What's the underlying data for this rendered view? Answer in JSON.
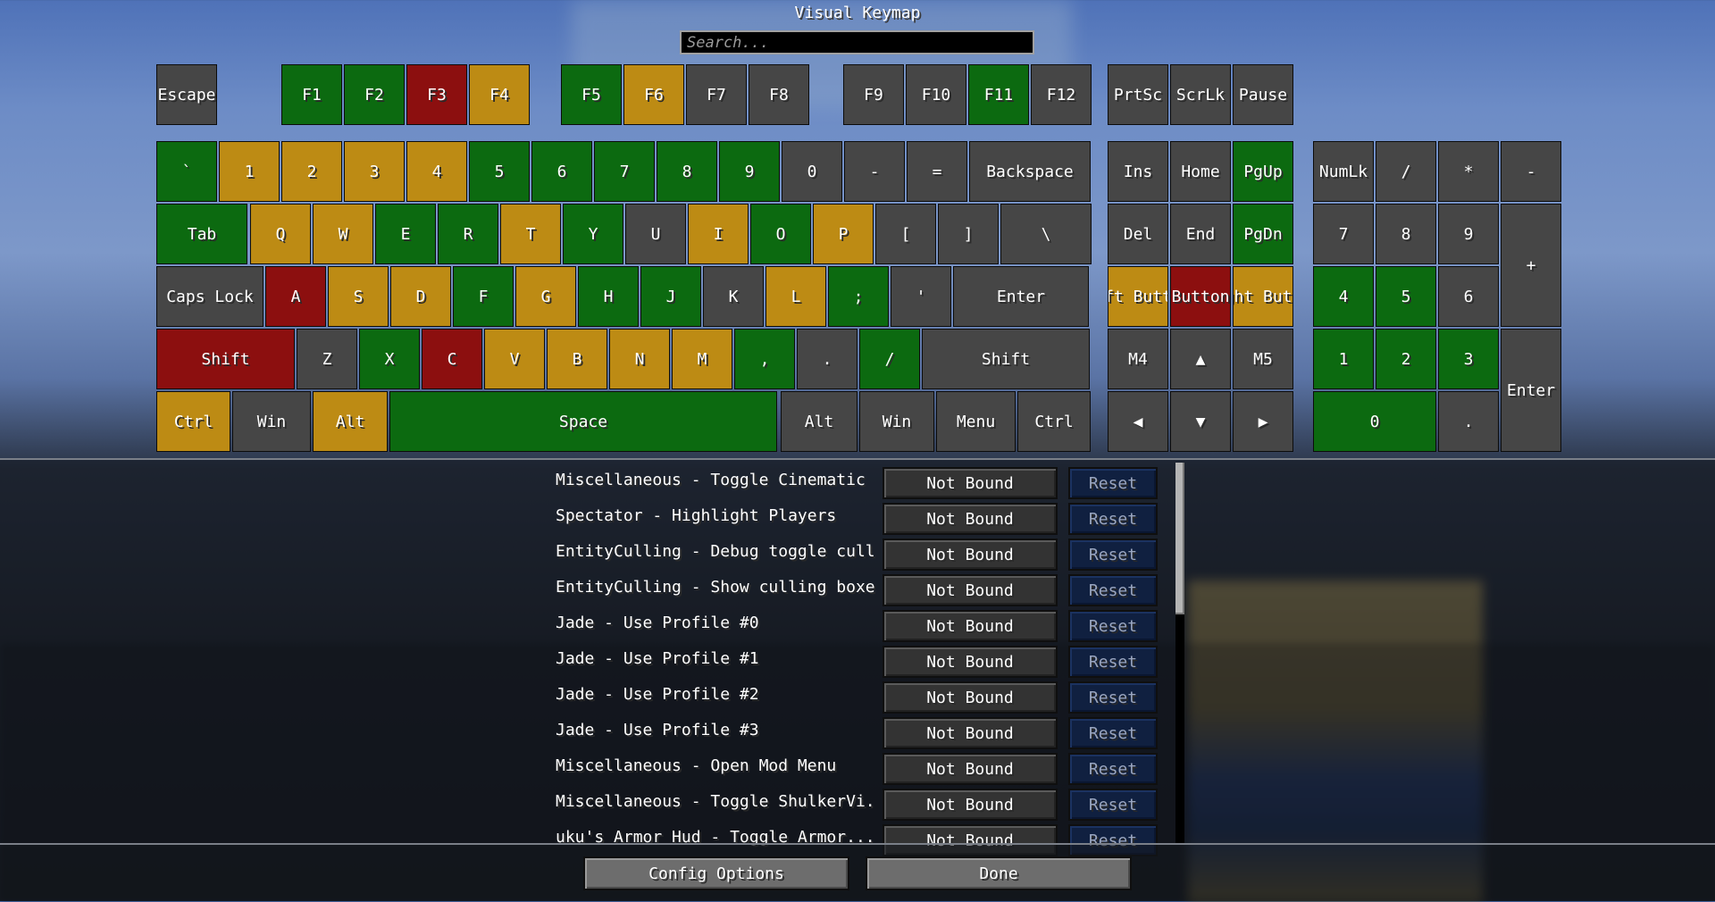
{
  "title": "Visual Keymap",
  "search": {
    "placeholder": "Search..."
  },
  "colors": {
    "bound_unique": "#0c6a10",
    "bound_other": "#bd8b14",
    "conflict": "#8c0f0f",
    "unbound": "#464646"
  },
  "keys": [
    {
      "label": "Escape",
      "state": "unbound"
    },
    {
      "label": "F1",
      "state": "bound_unique"
    },
    {
      "label": "F2",
      "state": "bound_unique"
    },
    {
      "label": "F3",
      "state": "conflict"
    },
    {
      "label": "F4",
      "state": "bound_other"
    },
    {
      "label": "F5",
      "state": "bound_unique"
    },
    {
      "label": "F6",
      "state": "bound_other"
    },
    {
      "label": "F7",
      "state": "unbound"
    },
    {
      "label": "F8",
      "state": "unbound"
    },
    {
      "label": "F9",
      "state": "unbound"
    },
    {
      "label": "F10",
      "state": "unbound"
    },
    {
      "label": "F11",
      "state": "bound_unique"
    },
    {
      "label": "F12",
      "state": "unbound"
    },
    {
      "label": "PrtSc",
      "state": "unbound"
    },
    {
      "label": "ScrLk",
      "state": "unbound"
    },
    {
      "label": "Pause",
      "state": "unbound"
    },
    {
      "label": "`",
      "state": "bound_unique"
    },
    {
      "label": "1",
      "state": "bound_other"
    },
    {
      "label": "2",
      "state": "bound_other"
    },
    {
      "label": "3",
      "state": "bound_other"
    },
    {
      "label": "4",
      "state": "bound_other"
    },
    {
      "label": "5",
      "state": "bound_unique"
    },
    {
      "label": "6",
      "state": "bound_unique"
    },
    {
      "label": "7",
      "state": "bound_unique"
    },
    {
      "label": "8",
      "state": "bound_unique"
    },
    {
      "label": "9",
      "state": "bound_unique"
    },
    {
      "label": "0",
      "state": "unbound"
    },
    {
      "label": "-",
      "state": "unbound"
    },
    {
      "label": "=",
      "state": "unbound"
    },
    {
      "label": "Backspace",
      "state": "unbound"
    },
    {
      "label": "Ins",
      "state": "unbound"
    },
    {
      "label": "Home",
      "state": "unbound"
    },
    {
      "label": "PgUp",
      "state": "bound_unique"
    },
    {
      "label": "NumLk",
      "state": "unbound"
    },
    {
      "label": "/",
      "state": "unbound"
    },
    {
      "label": "*",
      "state": "unbound"
    },
    {
      "label": "-",
      "state": "unbound"
    },
    {
      "label": "Tab",
      "state": "bound_unique"
    },
    {
      "label": "Q",
      "state": "bound_other"
    },
    {
      "label": "W",
      "state": "bound_other"
    },
    {
      "label": "E",
      "state": "bound_unique"
    },
    {
      "label": "R",
      "state": "bound_unique"
    },
    {
      "label": "T",
      "state": "bound_other"
    },
    {
      "label": "Y",
      "state": "bound_unique"
    },
    {
      "label": "U",
      "state": "unbound"
    },
    {
      "label": "I",
      "state": "bound_other"
    },
    {
      "label": "O",
      "state": "bound_unique"
    },
    {
      "label": "P",
      "state": "bound_other"
    },
    {
      "label": "[",
      "state": "unbound"
    },
    {
      "label": "]",
      "state": "unbound"
    },
    {
      "label": "\\",
      "state": "unbound"
    },
    {
      "label": "Del",
      "state": "unbound"
    },
    {
      "label": "End",
      "state": "unbound"
    },
    {
      "label": "PgDn",
      "state": "bound_unique"
    },
    {
      "label": "7",
      "state": "unbound"
    },
    {
      "label": "8",
      "state": "unbound"
    },
    {
      "label": "9",
      "state": "unbound"
    },
    {
      "label": "+",
      "state": "unbound"
    },
    {
      "label": "Caps Lock",
      "state": "unbound"
    },
    {
      "label": "A",
      "state": "conflict"
    },
    {
      "label": "S",
      "state": "bound_other"
    },
    {
      "label": "D",
      "state": "bound_other"
    },
    {
      "label": "F",
      "state": "bound_unique"
    },
    {
      "label": "G",
      "state": "bound_other"
    },
    {
      "label": "H",
      "state": "bound_unique"
    },
    {
      "label": "J",
      "state": "bound_unique"
    },
    {
      "label": "K",
      "state": "unbound"
    },
    {
      "label": "L",
      "state": "bound_other"
    },
    {
      "label": ";",
      "state": "bound_unique"
    },
    {
      "label": "'",
      "state": "unbound"
    },
    {
      "label": "Enter",
      "state": "unbound"
    },
    {
      "label": "Left Button",
      "state": "bound_other"
    },
    {
      "label": "Button",
      "state": "conflict"
    },
    {
      "label": "Right Button",
      "state": "bound_other"
    },
    {
      "label": "4",
      "state": "bound_unique"
    },
    {
      "label": "5",
      "state": "bound_unique"
    },
    {
      "label": "6",
      "state": "unbound"
    },
    {
      "label": "Shift",
      "state": "conflict"
    },
    {
      "label": "Z",
      "state": "unbound"
    },
    {
      "label": "X",
      "state": "bound_unique"
    },
    {
      "label": "C",
      "state": "conflict"
    },
    {
      "label": "V",
      "state": "bound_other"
    },
    {
      "label": "B",
      "state": "bound_other"
    },
    {
      "label": "N",
      "state": "bound_other"
    },
    {
      "label": "M",
      "state": "bound_other"
    },
    {
      "label": ",",
      "state": "bound_unique"
    },
    {
      "label": ".",
      "state": "unbound"
    },
    {
      "label": "/",
      "state": "bound_unique"
    },
    {
      "label": "Shift",
      "state": "unbound"
    },
    {
      "label": "M4",
      "state": "unbound"
    },
    {
      "label": "▲",
      "state": "unbound"
    },
    {
      "label": "M5",
      "state": "unbound"
    },
    {
      "label": "1",
      "state": "bound_unique"
    },
    {
      "label": "2",
      "state": "bound_unique"
    },
    {
      "label": "3",
      "state": "bound_unique"
    },
    {
      "label": "Enter",
      "state": "unbound"
    },
    {
      "label": "Ctrl",
      "state": "bound_other"
    },
    {
      "label": "Win",
      "state": "unbound"
    },
    {
      "label": "Alt",
      "state": "bound_other"
    },
    {
      "label": "Space",
      "state": "bound_unique"
    },
    {
      "label": "Alt",
      "state": "unbound"
    },
    {
      "label": "Win",
      "state": "unbound"
    },
    {
      "label": "Menu",
      "state": "unbound"
    },
    {
      "label": "Ctrl",
      "state": "unbound"
    },
    {
      "label": "◀",
      "state": "unbound"
    },
    {
      "label": "▼",
      "state": "unbound"
    },
    {
      "label": "▶",
      "state": "unbound"
    },
    {
      "label": "0",
      "state": "bound_unique"
    },
    {
      "label": ".",
      "state": "unbound"
    }
  ],
  "bindings": [
    {
      "name": "Miscellaneous - Toggle Cinematic ...",
      "key": "Not Bound",
      "reset": "Reset"
    },
    {
      "name": "Spectator - Highlight Players",
      "key": "Not Bound",
      "reset": "Reset"
    },
    {
      "name": "EntityCulling - Debug toggle culling",
      "key": "Not Bound",
      "reset": "Reset"
    },
    {
      "name": "EntityCulling - Show culling boxes",
      "key": "Not Bound",
      "reset": "Reset"
    },
    {
      "name": "Jade - Use Profile #0",
      "key": "Not Bound",
      "reset": "Reset"
    },
    {
      "name": "Jade - Use Profile #1",
      "key": "Not Bound",
      "reset": "Reset"
    },
    {
      "name": "Jade - Use Profile #2",
      "key": "Not Bound",
      "reset": "Reset"
    },
    {
      "name": "Jade - Use Profile #3",
      "key": "Not Bound",
      "reset": "Reset"
    },
    {
      "name": "Miscellaneous - Open Mod Menu",
      "key": "Not Bound",
      "reset": "Reset"
    },
    {
      "name": "Miscellaneous - Toggle ShulkerVi...",
      "key": "Not Bound",
      "reset": "Reset"
    },
    {
      "name": "uku's Armor Hud - Toggle Armor...",
      "key": "Not Bound",
      "reset": "Reset"
    }
  ],
  "footer": {
    "config_label": "Config Options",
    "done_label": "Done"
  }
}
